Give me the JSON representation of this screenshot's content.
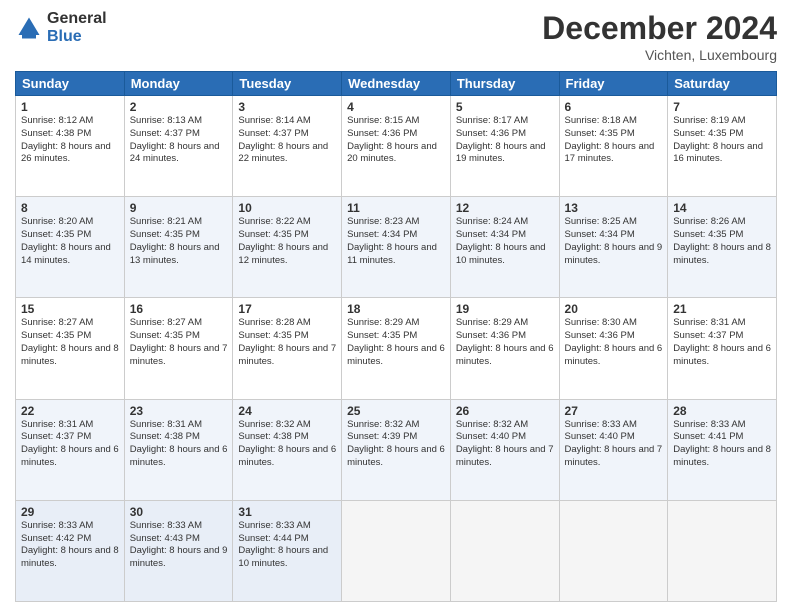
{
  "logo": {
    "general": "General",
    "blue": "Blue"
  },
  "header": {
    "month": "December 2024",
    "location": "Vichten, Luxembourg"
  },
  "days": [
    "Sunday",
    "Monday",
    "Tuesday",
    "Wednesday",
    "Thursday",
    "Friday",
    "Saturday"
  ],
  "weeks": [
    [
      {
        "day": "1",
        "sunrise": "8:12 AM",
        "sunset": "4:38 PM",
        "daylight": "8 hours and 26 minutes."
      },
      {
        "day": "2",
        "sunrise": "8:13 AM",
        "sunset": "4:37 PM",
        "daylight": "8 hours and 24 minutes."
      },
      {
        "day": "3",
        "sunrise": "8:14 AM",
        "sunset": "4:37 PM",
        "daylight": "8 hours and 22 minutes."
      },
      {
        "day": "4",
        "sunrise": "8:15 AM",
        "sunset": "4:36 PM",
        "daylight": "8 hours and 20 minutes."
      },
      {
        "day": "5",
        "sunrise": "8:17 AM",
        "sunset": "4:36 PM",
        "daylight": "8 hours and 19 minutes."
      },
      {
        "day": "6",
        "sunrise": "8:18 AM",
        "sunset": "4:35 PM",
        "daylight": "8 hours and 17 minutes."
      },
      {
        "day": "7",
        "sunrise": "8:19 AM",
        "sunset": "4:35 PM",
        "daylight": "8 hours and 16 minutes."
      }
    ],
    [
      {
        "day": "8",
        "sunrise": "8:20 AM",
        "sunset": "4:35 PM",
        "daylight": "8 hours and 14 minutes."
      },
      {
        "day": "9",
        "sunrise": "8:21 AM",
        "sunset": "4:35 PM",
        "daylight": "8 hours and 13 minutes."
      },
      {
        "day": "10",
        "sunrise": "8:22 AM",
        "sunset": "4:35 PM",
        "daylight": "8 hours and 12 minutes."
      },
      {
        "day": "11",
        "sunrise": "8:23 AM",
        "sunset": "4:34 PM",
        "daylight": "8 hours and 11 minutes."
      },
      {
        "day": "12",
        "sunrise": "8:24 AM",
        "sunset": "4:34 PM",
        "daylight": "8 hours and 10 minutes."
      },
      {
        "day": "13",
        "sunrise": "8:25 AM",
        "sunset": "4:34 PM",
        "daylight": "8 hours and 9 minutes."
      },
      {
        "day": "14",
        "sunrise": "8:26 AM",
        "sunset": "4:35 PM",
        "daylight": "8 hours and 8 minutes."
      }
    ],
    [
      {
        "day": "15",
        "sunrise": "8:27 AM",
        "sunset": "4:35 PM",
        "daylight": "8 hours and 8 minutes."
      },
      {
        "day": "16",
        "sunrise": "8:27 AM",
        "sunset": "4:35 PM",
        "daylight": "8 hours and 7 minutes."
      },
      {
        "day": "17",
        "sunrise": "8:28 AM",
        "sunset": "4:35 PM",
        "daylight": "8 hours and 7 minutes."
      },
      {
        "day": "18",
        "sunrise": "8:29 AM",
        "sunset": "4:35 PM",
        "daylight": "8 hours and 6 minutes."
      },
      {
        "day": "19",
        "sunrise": "8:29 AM",
        "sunset": "4:36 PM",
        "daylight": "8 hours and 6 minutes."
      },
      {
        "day": "20",
        "sunrise": "8:30 AM",
        "sunset": "4:36 PM",
        "daylight": "8 hours and 6 minutes."
      },
      {
        "day": "21",
        "sunrise": "8:31 AM",
        "sunset": "4:37 PM",
        "daylight": "8 hours and 6 minutes."
      }
    ],
    [
      {
        "day": "22",
        "sunrise": "8:31 AM",
        "sunset": "4:37 PM",
        "daylight": "8 hours and 6 minutes."
      },
      {
        "day": "23",
        "sunrise": "8:31 AM",
        "sunset": "4:38 PM",
        "daylight": "8 hours and 6 minutes."
      },
      {
        "day": "24",
        "sunrise": "8:32 AM",
        "sunset": "4:38 PM",
        "daylight": "8 hours and 6 minutes."
      },
      {
        "day": "25",
        "sunrise": "8:32 AM",
        "sunset": "4:39 PM",
        "daylight": "8 hours and 6 minutes."
      },
      {
        "day": "26",
        "sunrise": "8:32 AM",
        "sunset": "4:40 PM",
        "daylight": "8 hours and 7 minutes."
      },
      {
        "day": "27",
        "sunrise": "8:33 AM",
        "sunset": "4:40 PM",
        "daylight": "8 hours and 7 minutes."
      },
      {
        "day": "28",
        "sunrise": "8:33 AM",
        "sunset": "4:41 PM",
        "daylight": "8 hours and 8 minutes."
      }
    ],
    [
      {
        "day": "29",
        "sunrise": "8:33 AM",
        "sunset": "4:42 PM",
        "daylight": "8 hours and 8 minutes."
      },
      {
        "day": "30",
        "sunrise": "8:33 AM",
        "sunset": "4:43 PM",
        "daylight": "8 hours and 9 minutes."
      },
      {
        "day": "31",
        "sunrise": "8:33 AM",
        "sunset": "4:44 PM",
        "daylight": "8 hours and 10 minutes."
      },
      null,
      null,
      null,
      null
    ]
  ]
}
